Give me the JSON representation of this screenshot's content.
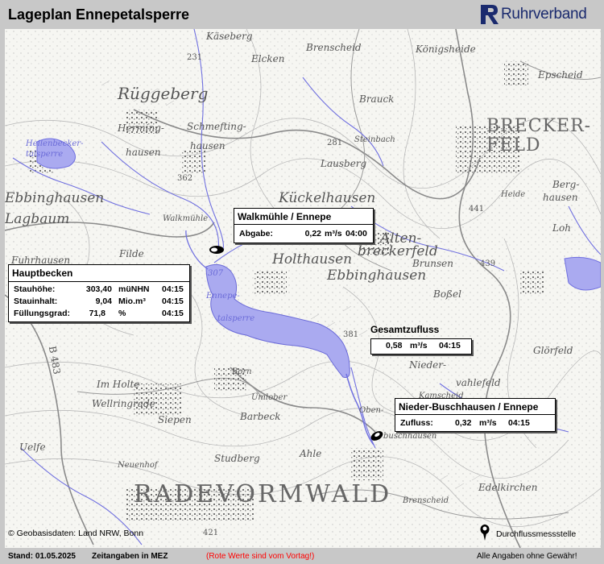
{
  "header": {
    "title": "Lageplan Ennepetalsperre",
    "logo_text": "Ruhrverband"
  },
  "map_labels": {
    "radevormwald": "RADEVORMWALD",
    "breckerfeld_1": "BRECKER-",
    "breckerfeld_2": "FELD",
    "ruggeberg": "Rüggeberg",
    "ebbinghausen": "Ebbinghausen",
    "holthausen": "Holthausen",
    "ebbinghausen2": "Ebbinghausen",
    "kuckelhausen": "Kückelhausen",
    "altenbreckerfeld_1": "Alten-",
    "altenbreckerfeld_2": "breckerfeld",
    "brauck": "Brauck",
    "brenscheid": "Brenscheid",
    "konigsheide": "Königsheide",
    "epscheid": "Epscheid",
    "kaseberg": "Käseberg",
    "elcken": "Elcken",
    "lausberg": "Lausberg",
    "steinbach": "Steinbach",
    "bergehausen_1": "Berg-",
    "bergehausen_2": "hausen",
    "loh": "Loh",
    "heide": "Heide",
    "bosel": "Boßel",
    "brunsen": "Brunsen",
    "glorfeld": "Glörfeld",
    "nieder": "Nieder-",
    "vahlefeld": "vahlefeld",
    "imholte": "Im Holte",
    "wellringrade": "Wellringrade",
    "siepen": "Siepen",
    "uelfe": "Uelfe",
    "barbeck": "Barbeck",
    "studberg": "Studberg",
    "ahle": "Ahle",
    "edelkirchen": "Edelkirchen",
    "brenscheid2": "Brenscheid",
    "walkmuehle": "Walkmühle",
    "filde": "Filde",
    "lagbaum": "Lagbaum",
    "fuhrhausen": "Fuhrhausen",
    "hohe_sensche": "Heilenbecker-\ntalsperre",
    "b483": "B 483",
    "ennepe": "Ennepe-",
    "talsperre": "talsperre",
    "307": "307",
    "362": "362",
    "381": "381",
    "281": "281",
    "231": "231",
    "441": "441",
    "439": "439",
    "421": "421",
    "hermingh_1": "Herming-",
    "hermingh_2": "hausen",
    "schmefting_1": "Schmefting-",
    "schmefting_2": "hausen",
    "oben": "Oben-",
    "buschhausen": "buschhausen",
    "kamscheid": "Kamscheid",
    "beckhausen": "Born",
    "neuenhof": "Neuenhof",
    "niederbarmbeck": "Umlober"
  },
  "stations": {
    "walkmuehle": {
      "title": "Walkmühle / Ennepe",
      "label": "Abgabe:",
      "value": "0,22",
      "unit": "m³/s",
      "time": "04:00"
    },
    "hauptbecken": {
      "title": "Hauptbecken",
      "rows": [
        {
          "label": "Stauhöhe:",
          "value": "303,40",
          "unit": "müNHN",
          "time": "04:15"
        },
        {
          "label": "Stauinhalt:",
          "value": "9,04",
          "unit": "Mio.m³",
          "time": "04:15"
        },
        {
          "label": "Füllungsgrad:",
          "value": "71,8",
          "unit": "%",
          "time": "04:15"
        }
      ]
    },
    "gesamtzufluss": {
      "title": "Gesamtzufluss",
      "value": "0,58",
      "unit": "m³/s",
      "time": "04:15"
    },
    "niederbuschhausen": {
      "title": "Nieder-Buschhausen / Ennepe",
      "label": "Zufluss:",
      "value": "0,32",
      "unit": "m³/s",
      "time": "04:15"
    }
  },
  "legend": {
    "label": "Durchflussmessstelle",
    "copyright": "© Geobasisdaten: Land NRW, Bonn"
  },
  "footer": {
    "stand": "Stand: 01.05.2025",
    "zeitangaben": "Zeitangaben in MEZ",
    "vortag": "(Rote Werte sind vom Vortag!)",
    "gewaehr": "Alle Angaben ohne Gewähr!"
  },
  "colors": {
    "background": "#c8c8c8",
    "water": "#aaaaf0",
    "stream": "#7070e0",
    "vortag_red": "#ff0000",
    "logo_blue": "#1a2a6e"
  },
  "icons": {
    "logo": "ruhrverband-logo-icon",
    "gauge": "pin-icon"
  }
}
